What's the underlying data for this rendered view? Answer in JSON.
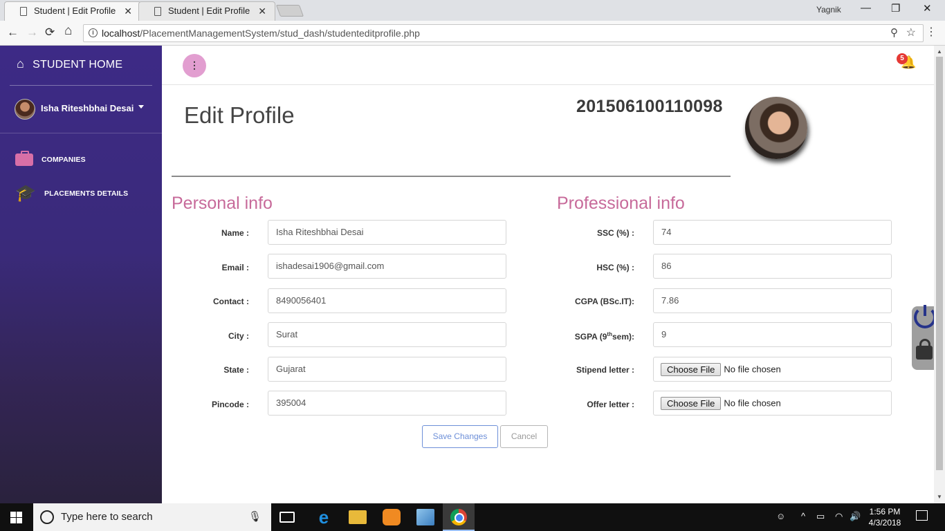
{
  "browser": {
    "tabs": [
      {
        "title": "Student | Edit Profile",
        "active": true
      },
      {
        "title": "Student | Edit Profile",
        "active": false
      }
    ],
    "tab_close": "✕",
    "window_user": "Yagnik",
    "window_controls": {
      "minimize": "—",
      "restore": "❐",
      "close": "✕"
    },
    "nav": {
      "back": "←",
      "forward": "→",
      "reload": "⟳",
      "home": "⌂"
    },
    "url_host": "localhost",
    "url_path": "/PlacementManagementSystem/stud_dash/studenteditprofile.php",
    "info_icon": "i",
    "zoom_icon": "⚲",
    "star_icon": "☆",
    "menu_icon": "⋮"
  },
  "sidebar": {
    "home_icon": "⌂",
    "home_label": "STUDENT HOME",
    "user_name": "Isha Riteshbhai Desai",
    "items": [
      {
        "label": "COMPANIES",
        "icon": "briefcase-icon"
      },
      {
        "label": "PLACEMENTS DETAILS",
        "icon": "graduation-cap-icon"
      }
    ],
    "cap_glyph": "🎓"
  },
  "header": {
    "kebab": "⋮",
    "bell": "🔔",
    "notification_count": "5"
  },
  "profile": {
    "title": "Edit Profile",
    "enrollment_no": "201506100110098"
  },
  "personal": {
    "heading": "Personal info",
    "fields": [
      {
        "label": "Name :",
        "value": "Isha Riteshbhai Desai"
      },
      {
        "label": "Email :",
        "value": "ishadesai1906@gmail.com"
      },
      {
        "label": "Contact :",
        "value": "8490056401"
      },
      {
        "label": "City :",
        "value": "Surat"
      },
      {
        "label": "State :",
        "value": "Gujarat"
      },
      {
        "label": "Pincode :",
        "value": "395004"
      }
    ]
  },
  "professional": {
    "heading": "Professional info",
    "ssc_label": "SSC (%) :",
    "ssc": "74",
    "hsc_label": "HSC (%) :",
    "hsc": "86",
    "cgpa_label": "CGPA (BSc.IT):",
    "cgpa": "7.86",
    "sgpa_label_pre": "SGPA (9",
    "sgpa_label_sup": "th",
    "sgpa_label_post": "sem):",
    "sgpa": "9",
    "stipend_label": "Stipend letter :",
    "offer_label": "Offer letter :",
    "choose_file": "Choose File",
    "no_file": "No file chosen"
  },
  "actions": {
    "save": "Save Changes",
    "cancel": "Cancel"
  },
  "taskbar": {
    "search_placeholder": "Type here to search",
    "mic": "🎙",
    "time": "1:56 PM",
    "date": "4/3/2018",
    "tray_people": "☺",
    "tray_chevron": "^",
    "tray_battery": "▭",
    "tray_wifi": "◠",
    "tray_volume": "🔊",
    "edge_glyph": "e"
  },
  "colors": {
    "accent_pink": "#c76a9a",
    "sidebar_purple": "#3d2a86",
    "save_blue": "#6d8fd8"
  }
}
